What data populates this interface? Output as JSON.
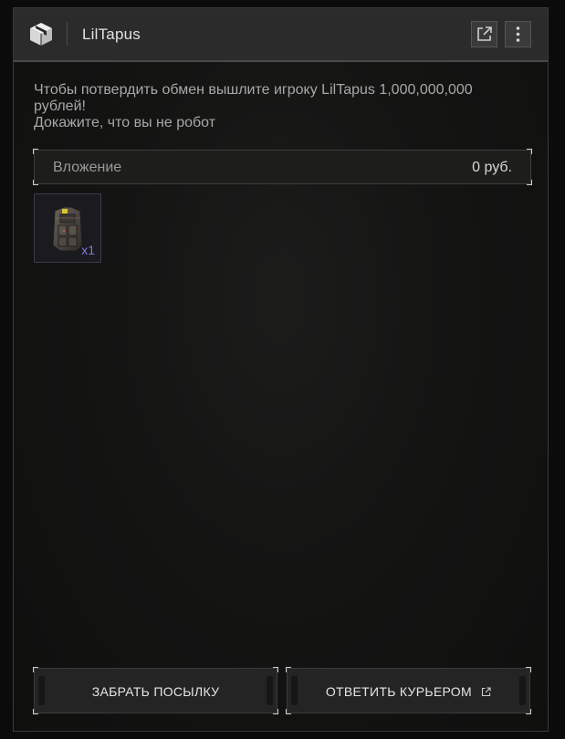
{
  "window": {
    "title": "LilTapus",
    "icons": [
      "box-icon",
      "popout-icon",
      "more-vertical-icon"
    ]
  },
  "message": {
    "line1": "Чтобы потвердить обмен вышлите игроку LilTapus 1,000,000,000",
    "line2": "рублей!",
    "line3": "Докажите, что вы не робот"
  },
  "attachment": {
    "label": "Вложение",
    "value": "0 руб."
  },
  "items": [
    {
      "icon": "armor-vest-icon",
      "quantity": "x1"
    }
  ],
  "actions": {
    "take_label": "ЗАБРАТЬ ПОСЫЛКУ",
    "reply_label": "ОТВЕТИТЬ КУРЬЕРОМ",
    "reply_icon": "external-link-icon"
  },
  "colors": {
    "accent_quantity": "#7d79e0",
    "titlebar": "#2b2b2b"
  }
}
